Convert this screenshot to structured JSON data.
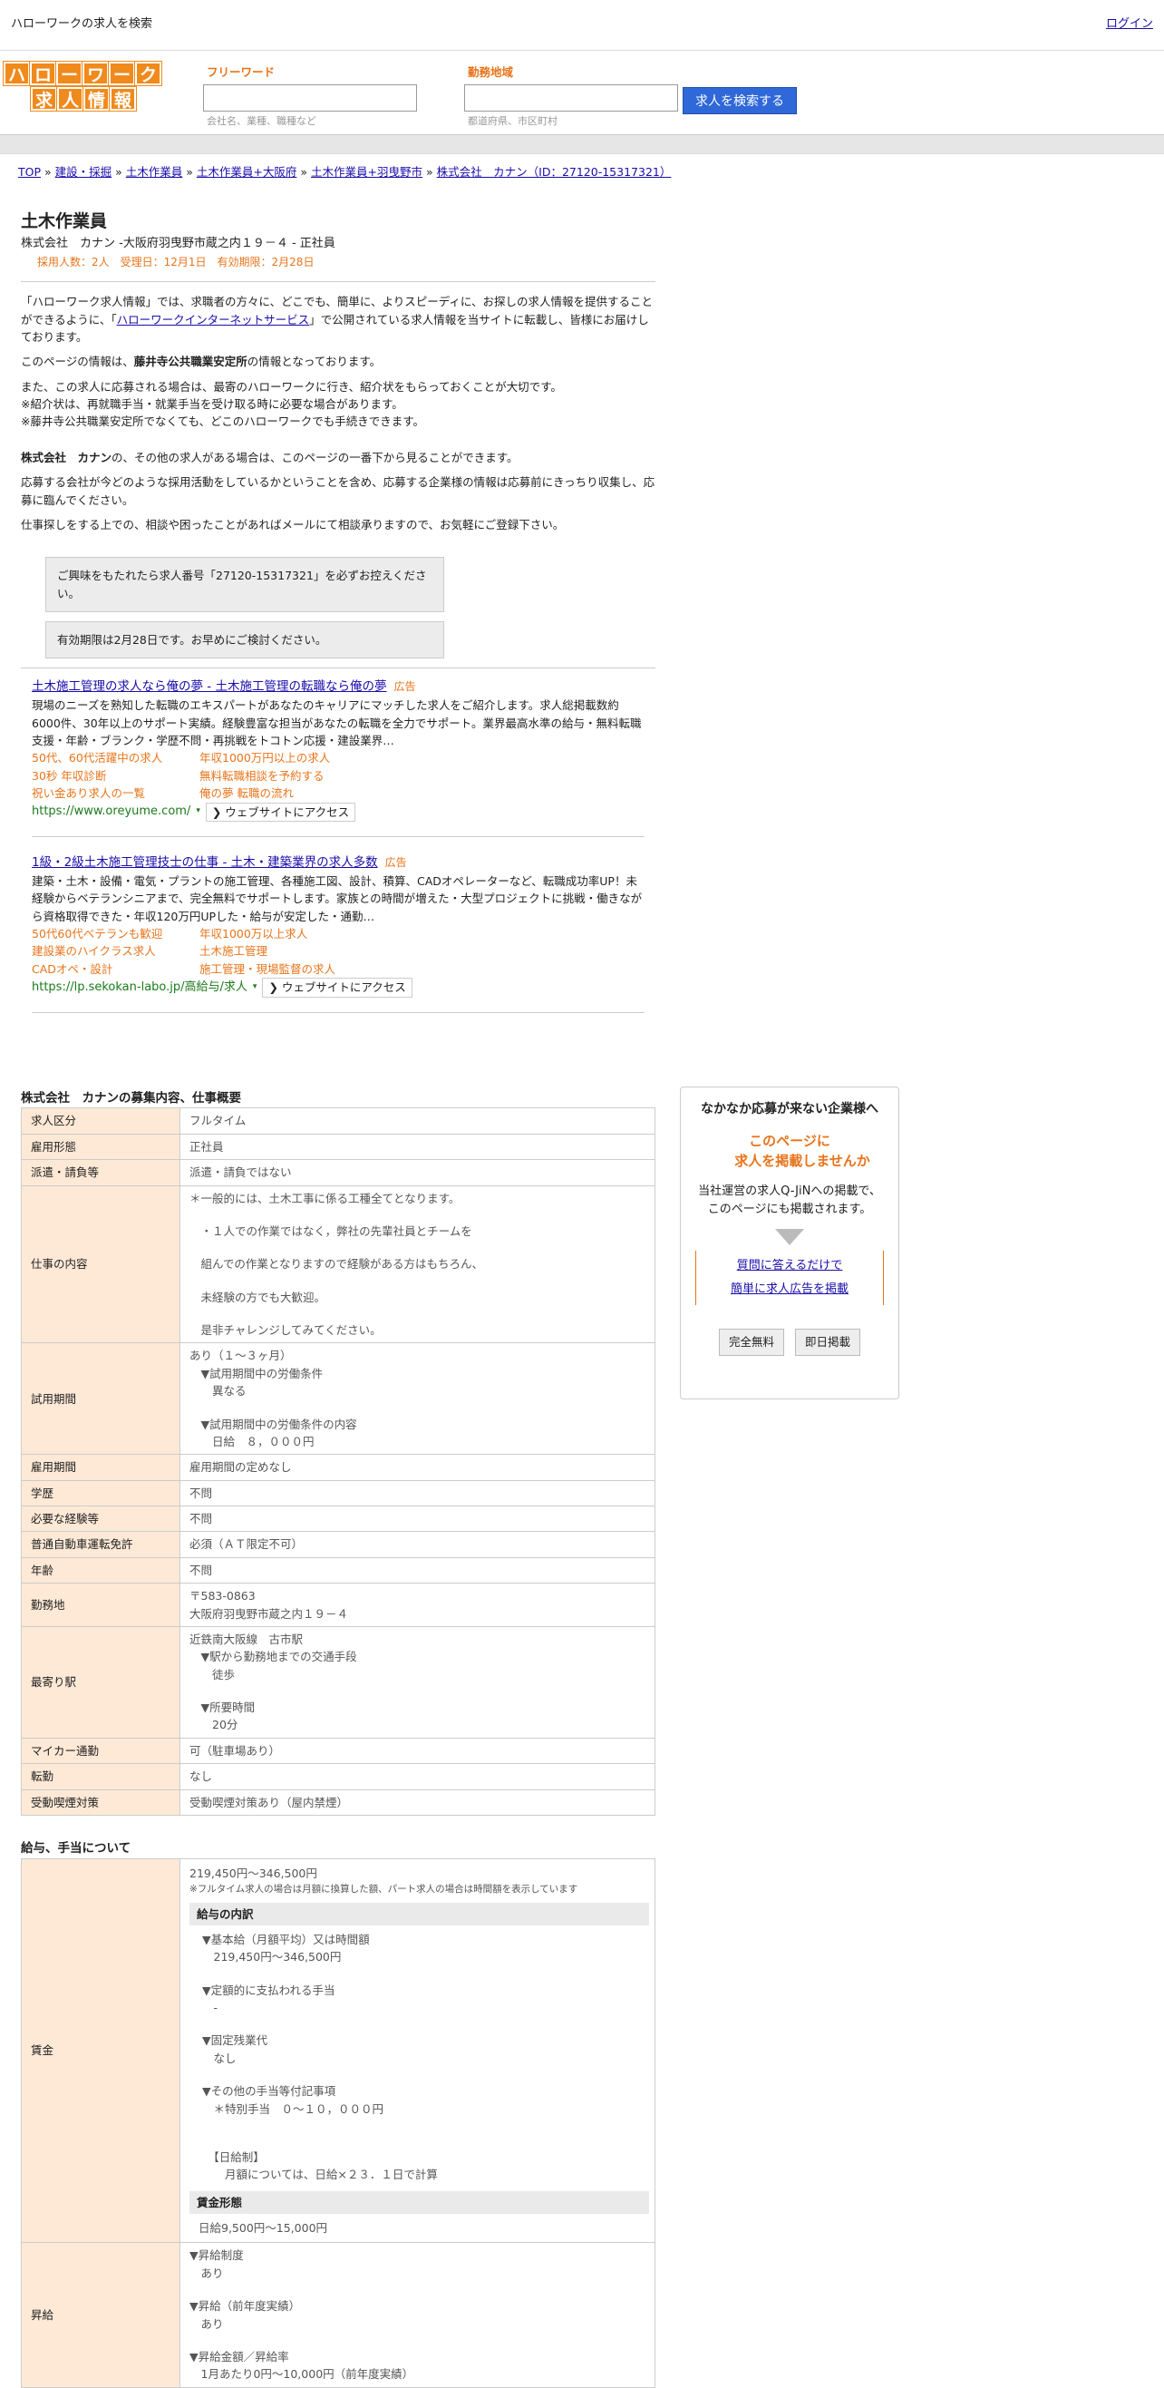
{
  "topbar": {
    "title": "ハローワークの求人を検索",
    "login": "ログイン"
  },
  "logo": {
    "top": [
      "ハ",
      "ロ",
      "ー",
      "ワ",
      "ー",
      "ク"
    ],
    "bottom": [
      "求",
      "人",
      "情",
      "報"
    ]
  },
  "search": {
    "freeword_label": "フリーワード",
    "freeword_hint": "会社名、業種、職種など",
    "area_label": "勤務地域",
    "area_hint": "都道府県、市区町村",
    "button": "求人を検索する"
  },
  "breadcrumb": {
    "items": [
      "TOP",
      "建設・採掘",
      "土木作業員",
      "土木作業員+大阪府",
      "土木作業員+羽曳野市",
      "株式会社　カナン（ID：27120-15317321）"
    ],
    "sep": "»"
  },
  "job": {
    "title": "土木作業員",
    "subtitle": "株式会社　カナン -大阪府羽曳野市蔵之内１９－４ - 正社員",
    "meta": "採用人数：2人　受理日：12月1日　有効期限：2月28日"
  },
  "intro": {
    "p1a": "「ハローワーク求人情報」では、求職者の方々に、どこでも、簡単に、よりスピーディに、お探しの求人情報を提供することができるように、「",
    "p1link": "ハローワークインターネットサービス",
    "p1b": "」で公開されている求人情報を当サイトに転載し、皆様にお届けしております。",
    "p2a": "このページの情報は、",
    "p2b": "藤井寺公共職業安定所",
    "p2c": "の情報となっております。",
    "p3": "また、この求人に応募される場合は、最寄のハローワークに行き、紹介状をもらっておくことが大切です。",
    "p4": "※紹介状は、再就職手当・就業手当を受け取る時に必要な場合があります。",
    "p5": "※藤井寺公共職業安定所でなくても、どこのハローワークでも手続きできます。",
    "p6a": "株式会社　カナン",
    "p6b": "の、その他の求人がある場合は、このページの一番下から見ることができます。",
    "p7": "応募する会社が今どのような採用活動をしているかということを含め、応募する企業様の情報は応募前にきっちり収集し、応募に臨んでください。",
    "p8": "仕事探しをする上での、相談や困ったことがあればメールにて相談承りますので、お気軽にご登録下さい。"
  },
  "notices": [
    "ご興味をもたれたら求人番号「27120-15317321」を必ずお控えください。",
    "有効期限は2月28日です。お早めにご検討ください。"
  ],
  "ads": [
    {
      "title": "土木施工管理の求人なら俺の夢 - 土木施工管理の転職なら俺の夢",
      "label": "広告",
      "desc": "現場のニーズを熟知した転職のエキスパートがあなたのキャリアにマッチした求人をご紹介します。求人総掲載数約6000件、30年以上のサポート実績。経験豊富な担当があなたの転職を全力でサポート。業界最高水準の給与・無料転職支援・年齢・ブランク・学歴不問・再挑戦をトコトン応援・建設業界…",
      "links": [
        "50代、60代活躍中の求人",
        "年収1000万円以上の求人",
        "30秒 年収診断",
        "無料転職相談を予約する",
        "祝い金あり求人の一覧",
        "俺の夢 転職の流れ"
      ],
      "url": "https://www.oreyume.com/",
      "visit": "❯ ウェブサイトにアクセス"
    },
    {
      "title": "1級・2級土木施工管理技士の仕事 - 土木・建築業界の求人多数",
      "label": "広告",
      "desc": "建築・土木・設備・電気・プラントの施工管理、各種施工図、設計、積算、CADオペレーターなど、転職成功率UP！未経験からベテランシニアまで、完全無料でサポートします。家族との時間が増えた・大型プロジェクトに挑戦・働きながら資格取得できた・年収120万円UPした・給与が安定した・通勤…",
      "links": [
        "50代60代ベテランも歓迎",
        "年収1000万以上求人",
        "建設業のハイクラス求人",
        "土木施工管理",
        "CADオペ・設計",
        "施工管理・現場監督の求人"
      ],
      "url": "https://lp.sekokan-labo.jp/高給与/求人",
      "visit": "❯ ウェブサイトにアクセス"
    }
  ],
  "overview": {
    "title": "株式会社　カナンの募集内容、仕事概要",
    "rows": [
      {
        "k": "求人区分",
        "v": [
          "フルタイム"
        ]
      },
      {
        "k": "雇用形態",
        "v": [
          "正社員"
        ]
      },
      {
        "k": "派遣・請負等",
        "v": [
          "派遣・請負ではない"
        ]
      },
      {
        "k": "仕事の内容",
        "v": [
          "＊一般的には、土木工事に係る工種全てとなります。",
          "",
          "　・１人での作業ではなく，弊社の先輩社員とチームを",
          "",
          "　組んでの作業となりますので経験がある方はもちろん、",
          "",
          "　未経験の方でも大歓迎。",
          "",
          "　是非チャレンジしてみてください。"
        ]
      },
      {
        "k": "試用期間",
        "v": [
          "あり（１～３ヶ月）",
          "　▼試用期間中の労働条件",
          "　　異なる",
          "",
          "　▼試用期間中の労働条件の内容",
          "　　日給　８，０００円"
        ]
      },
      {
        "k": "雇用期間",
        "v": [
          "雇用期間の定めなし"
        ]
      },
      {
        "k": "学歴",
        "v": [
          "不問"
        ]
      },
      {
        "k": "必要な経験等",
        "v": [
          "不問"
        ]
      },
      {
        "k": "普通自動車運転免許",
        "v": [
          "必須（ＡＴ限定不可）"
        ]
      },
      {
        "k": "年齢",
        "v": [
          "不問"
        ]
      },
      {
        "k": "勤務地",
        "v": [
          "〒583-0863",
          "大阪府羽曳野市蔵之内１９－４"
        ]
      },
      {
        "k": "最寄り駅",
        "v": [
          "近鉄南大阪線　古市駅",
          "　▼駅から勤務地までの交通手段",
          "　　徒歩",
          "",
          "　▼所要時間",
          "　　20分"
        ]
      },
      {
        "k": "マイカー通勤",
        "v": [
          "可（駐車場あり）"
        ]
      },
      {
        "k": "転勤",
        "v": [
          "なし"
        ]
      },
      {
        "k": "受動喫煙対策",
        "v": [
          "受動喫煙対策あり（屋内禁煙）"
        ]
      }
    ]
  },
  "salary": {
    "title": "給与、手当について",
    "wage_key": "賃金",
    "range": "219,450円〜346,500円",
    "note": "※フルタイム求人の場合は月額に換算した額、パート求人の場合は時間額を表示しています",
    "breakdown_title": "給与の内訳",
    "breakdown": [
      "▼基本給（月額平均）又は時間額",
      "　219,450円〜346,500円",
      "",
      "▼定額的に支払われる手当",
      "　-",
      "",
      "▼固定残業代",
      "　なし",
      "",
      "▼その他の手当等付記事項",
      "　＊特別手当　０～１０，０００円",
      "",
      "",
      "　【日給制】",
      "　　月額については、日給×２３．１日で計算"
    ],
    "form_title": "賃金形態",
    "form_value": "日給9,500円〜15,000円",
    "raise_key": "昇給",
    "raise": [
      "▼昇給制度",
      "　あり",
      "",
      "▼昇給（前年度実績）",
      "　あり",
      "",
      "▼昇給金額／昇給率",
      "　1月あたり0円～10,000円（前年度実績）"
    ]
  },
  "side": {
    "h1": "なかなか応募が来ない企業様へ",
    "h2a": "このページに",
    "h2b": "求人を掲載しませんか",
    "body1": "当社運営の求人Q-JiNへの掲載で、",
    "body2": "このページにも掲載されます。",
    "link1": "質問に答えるだけで",
    "link2": "簡単に求人広告を掲載",
    "btn1": "完全無料",
    "btn2": "即日掲載"
  }
}
